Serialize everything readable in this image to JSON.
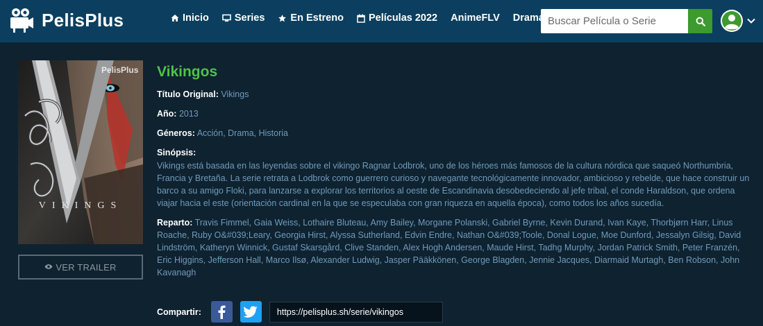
{
  "brand": {
    "name": "PelisPlus"
  },
  "nav": [
    {
      "label": "Inicio",
      "icon": "home-icon"
    },
    {
      "label": "Series",
      "icon": "monitor-icon"
    },
    {
      "label": "En Estreno",
      "icon": "star-icon"
    },
    {
      "label": "Películas 2022",
      "icon": "calendar-icon"
    },
    {
      "label": "AnimeFLV",
      "icon": ""
    },
    {
      "label": "Drama",
      "icon": ""
    }
  ],
  "search": {
    "placeholder": "Buscar Película o Serie",
    "value": ""
  },
  "colors": {
    "header": "#0c3f5f",
    "accent_green": "#3c9a2e",
    "title_green": "#4fc24a",
    "link_blue": "#6f9bb9",
    "background": "#0f2230"
  },
  "poster": {
    "watermark": "PelisPlus",
    "poster_text": "VIKINGS"
  },
  "trailer": {
    "label": "VER TRAILER"
  },
  "show": {
    "title": "Vikingos",
    "original_title_label": "Título Original:",
    "original_title": "Vikings",
    "year_label": "Año:",
    "year": "2013",
    "genres_label": "Géneros:",
    "genres": "Acción, Drama, Historia",
    "synopsis_label": "Sinópsis:",
    "synopsis": "Vikings está basada en las leyendas sobre el vikingo Ragnar Lodbrok, uno de los héroes más famosos de la cultura nórdica que saqueó Northumbria, Francia y Bretaña. La serie retrata a Lodbrok como guerrero curioso y navegante tecnológicamente innovador, ambicioso y rebelde, que hace construir un barco a su amigo Floki, para lanzarse a explorar los territorios al oeste de Escandinavia desobedeciendo al jefe tribal, el conde Haraldson, que ordena viajar hacia el este (orientación cardinal en la que se especulaba con gran riqueza en aquella época), como todos los años sucedía.",
    "cast_label": "Reparto:",
    "cast": "Travis Fimmel, Gaia Weiss, Lothaire Bluteau, Amy Bailey, Morgane Polanski, Gabriel Byrne, Kevin Durand, Ivan Kaye, Thorbjørn Harr, Linus Roache, Ruby O&#039;Leary, Georgia Hirst, Alyssa Sutherland, Edvin Endre, Nathan O&#039;Toole, Donal Logue, Moe Dunford, Jessalyn Gilsig, David Lindström, Katheryn Winnick, Gustaf Skarsgård, Clive Standen, Alex Hogh Andersen, Maude Hirst, Tadhg Murphy, Jordan Patrick Smith, Peter Franzén, Eric Higgins, Jefferson Hall, Marco Ilsø, Alexander Ludwig, Jasper Pääkkönen, George Blagden, Jennie Jacques, Diarmaid Murtagh, Ben Robson, John Kavanagh"
  },
  "share": {
    "label": "Compartir:",
    "url": "https://pelisplus.sh/serie/vikingos"
  }
}
